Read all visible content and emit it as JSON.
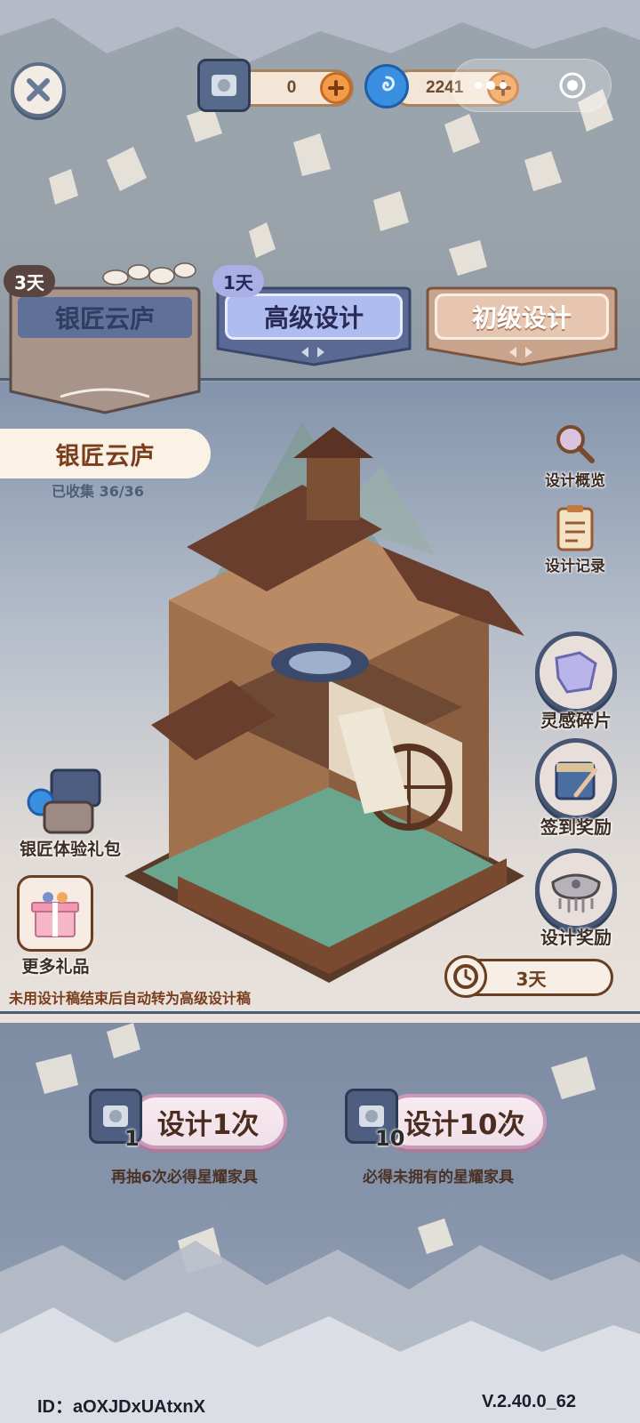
{
  "colors": {
    "accent_orange": "#f29b49",
    "banner_dark": "#4b5d7d",
    "title_brown": "#7a3d1c",
    "draw_pink": "#f0dfe8"
  },
  "top_bar": {
    "close_icon": "close-icon",
    "design_token_count": "0",
    "crystal_count": "2241"
  },
  "banner_tabs": [
    {
      "label": "银匠云庐",
      "days": "3天",
      "state": "selected"
    },
    {
      "label": "高级设计",
      "days": "1天",
      "state": "normal"
    },
    {
      "label": "初级设计",
      "days": "",
      "state": "normal"
    }
  ],
  "pool": {
    "title": "银匠云庐",
    "collected": "已收集 36/36"
  },
  "side_menu": {
    "overview": "设计概览",
    "records": "设计记录",
    "fragments": "灵感碎片",
    "checkin": "签到奖励",
    "design_reward": "设计奖励"
  },
  "left_menu": {
    "experience_pack": "银匠体验礼包",
    "more_gifts": "更多礼品"
  },
  "timer": {
    "label": "3天"
  },
  "notice": "未用设计稿结束后自动转为高级设计稿",
  "draws": [
    {
      "label": "设计1次",
      "cost": "1",
      "note": "再抽6次必得星耀家具"
    },
    {
      "label": "设计10次",
      "cost": "10",
      "note": "必得未拥有的星耀家具"
    }
  ],
  "footer": {
    "id": "ID：aOXJDxUAtxnX",
    "version": "V.2.40.0_62"
  }
}
